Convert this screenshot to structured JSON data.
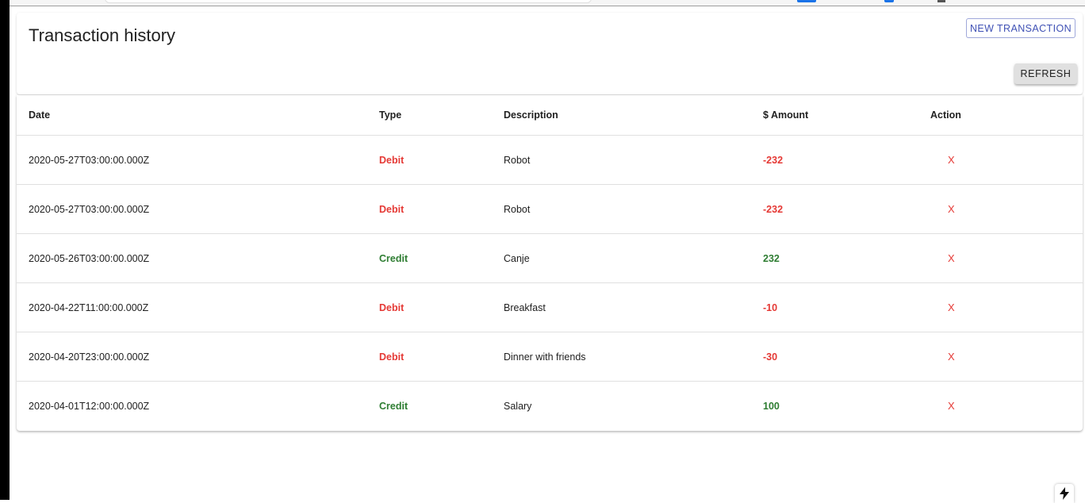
{
  "header": {
    "title": "Transaction history",
    "new_transaction_label": "NEW TRANSACTION",
    "refresh_label": "REFRESH"
  },
  "table": {
    "columns": [
      "Date",
      "Type",
      "Description",
      "$ Amount",
      "Action"
    ],
    "rows": [
      {
        "date": "2020-05-27T03:00:00.000Z",
        "type": "Debit",
        "description": "Robot",
        "amount": "-232",
        "action": "X"
      },
      {
        "date": "2020-05-27T03:00:00.000Z",
        "type": "Debit",
        "description": "Robot",
        "amount": "-232",
        "action": "X"
      },
      {
        "date": "2020-05-26T03:00:00.000Z",
        "type": "Credit",
        "description": "Canje",
        "amount": "232",
        "action": "X"
      },
      {
        "date": "2020-04-22T11:00:00.000Z",
        "type": "Debit",
        "description": "Breakfast",
        "amount": "-10",
        "action": "X"
      },
      {
        "date": "2020-04-20T23:00:00.000Z",
        "type": "Debit",
        "description": "Dinner with friends",
        "amount": "-30",
        "action": "X"
      },
      {
        "date": "2020-04-01T12:00:00.000Z",
        "type": "Credit",
        "description": "Salary",
        "amount": "100",
        "action": "X"
      }
    ]
  },
  "colors": {
    "debit": "#e53935",
    "credit": "#2e7d32",
    "primary": "#3f51b5"
  },
  "icons": {
    "corner_button": "lightning-bolt-icon"
  }
}
